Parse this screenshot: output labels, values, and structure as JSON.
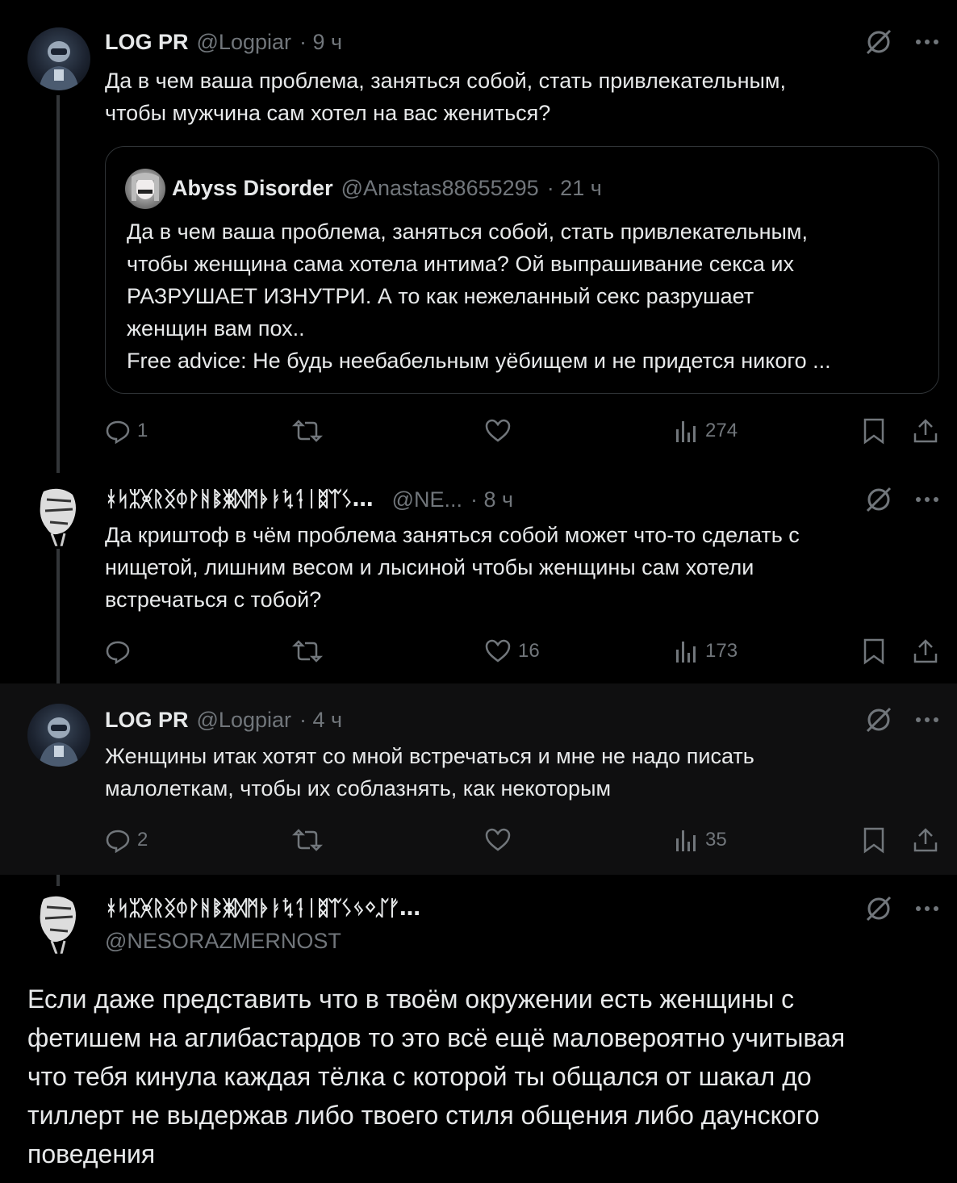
{
  "post1": {
    "name": "LOG PR",
    "handle": "@Logpiar",
    "time": "· 9 ч",
    "text_lines": [
      "Да в чем ваша проблема, заняться собой, стать привлекательным,",
      "чтобы мужчина сам хотел на вас жениться?"
    ],
    "quote": {
      "name": "Abyss Disorder",
      "handle": "@Anastas88655295",
      "time": "· 21 ч",
      "text_lines": [
        "Да в чем ваша проблема, заняться собой, стать привлекательным,",
        "чтобы женщина сама хотела интима? Ой выпрашивание секса их",
        "РАЗРУШАЕТ ИЗНУТРИ. А то как нежеланный секс разрушает",
        "женщин вам пох..",
        "Free advice: Не будь неебабельным уёбищем и не придется никого ..."
      ]
    },
    "replies": "1",
    "reposts": "",
    "likes": "",
    "views": "274"
  },
  "post2": {
    "name": "ᚼᛋᛯᚸᚱᛝᛰᚹᚻᛔᛤᛞᛗᚧᛓᛪᛑᛁᛥᛠᛊ…",
    "handle": "@NE...",
    "time": "· 8 ч",
    "text_lines": [
      "Да криштоф в чём проблема заняться собой может что-то сделать с",
      "нищетой, лишним весом и лысиной чтобы женщины сам хотели",
      "встречаться с тобой?"
    ],
    "replies": "",
    "reposts": "",
    "likes": "16",
    "views": "173"
  },
  "post3": {
    "name": "LOG PR",
    "handle": "@Logpiar",
    "time": "· 4 ч",
    "text_lines": [
      "Женщины итак хотят со мной встречаться и мне не надо писать",
      "малолеткам, чтобы их соблазнять, как некоторым"
    ],
    "replies": "2",
    "reposts": "",
    "likes": "",
    "views": "35"
  },
  "post4": {
    "name": "ᚼᛋᛯᚸᚱᛝᛰᚹᚻᛔᛤᛞᛗᚧᛓᛪᛑᛁᛥᛠᛊᛃᛜᛢᚠ…",
    "handle": "@NESORAZMERNOST",
    "text_lines": [
      "Если даже представить что в твоём окружении есть женщины с",
      "фетишем на аглибастардов то это всё ещё маловероятно учитывая",
      "что тебя кинула каждая тёлка с которой ты общался от шакал до",
      "тиллерт не выдержав либо твоего стиля общения либо даунского",
      "поведения"
    ]
  },
  "colors": {
    "background": "#000000",
    "text": "#e7e9ea",
    "muted": "#71767b",
    "border": "#2f3336"
  }
}
